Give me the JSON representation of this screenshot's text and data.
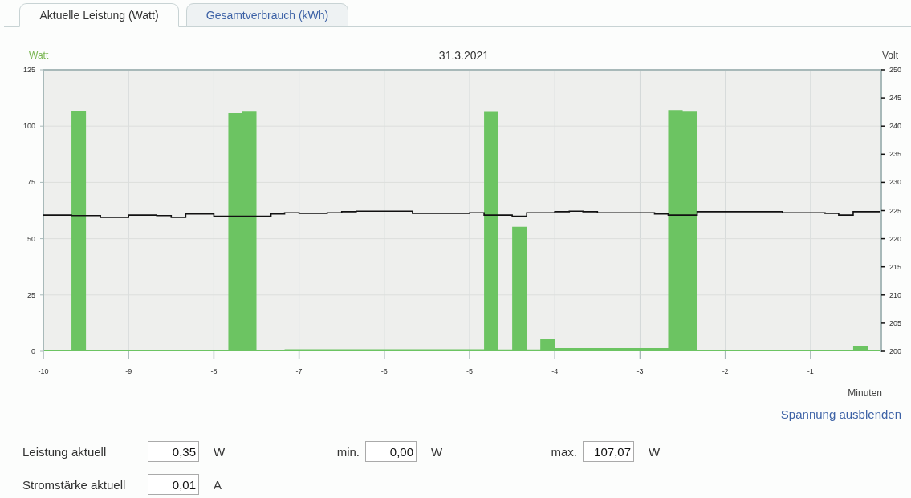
{
  "tabs": [
    {
      "label": "Aktuelle Leistung (Watt)",
      "selected": true
    },
    {
      "label": "Gesamtverbrauch (kWh)",
      "selected": false
    }
  ],
  "chart": {
    "chart_data": {
      "type": "area",
      "title": "31.3.2021",
      "xlabel": "Minuten",
      "ylabel": "Watt",
      "grid": true,
      "x": [
        -10,
        -9.83,
        -9.67,
        -9.5,
        -9.33,
        -9.17,
        -9,
        -8.83,
        -8.67,
        -8.5,
        -8.33,
        -8.17,
        -8,
        -7.83,
        -7.67,
        -7.5,
        -7.33,
        -7.17,
        -7,
        -6.83,
        -6.67,
        -6.5,
        -6.33,
        -6.17,
        -6,
        -5.83,
        -5.67,
        -5.5,
        -5.33,
        -5.17,
        -5,
        -4.83,
        -4.67,
        -4.5,
        -4.33,
        -4.17,
        -4,
        -3.83,
        -3.67,
        -3.5,
        -3.33,
        -3.17,
        -3,
        -2.83,
        -2.67,
        -2.5,
        -2.33,
        -2.17,
        -2,
        -1.83,
        -1.67,
        -1.5,
        -1.33,
        -1.17,
        -1,
        -0.83,
        -0.67,
        -0.5,
        -0.33,
        -0.17
      ],
      "series": [
        {
          "color": "#6cc462",
          "values": [
            0.3,
            0.3,
            106.5,
            0.3,
            0.3,
            0.3,
            0.3,
            0.3,
            0.3,
            0.3,
            0.3,
            0.3,
            0.3,
            105.8,
            106.4,
            0.3,
            0.2,
            0.9,
            0.9,
            0.9,
            0.9,
            0.9,
            0.9,
            0.9,
            0.9,
            0.9,
            0.9,
            0.9,
            0.9,
            0.9,
            0.9,
            106.3,
            0.8,
            55.3,
            0.8,
            5.3,
            1.4,
            1.4,
            1.4,
            1.4,
            1.4,
            1.4,
            1.4,
            1.4,
            107.1,
            106.4,
            0.3,
            0.3,
            0.3,
            0.3,
            0.3,
            0.3,
            0.3,
            0.6,
            0.6,
            0.6,
            0.6,
            2.5,
            0.4,
            0.4
          ]
        }
      ],
      "xlim": [
        -10,
        -0.17
      ],
      "ylim": [
        0,
        125
      ],
      "xticks": [
        -10,
        -9,
        -8,
        -7,
        -6,
        -5,
        -4,
        -3,
        -2,
        -1
      ],
      "yticks": [
        0,
        25,
        50,
        75,
        100,
        125
      ]
    }
  },
  "voltage_chart": {
    "chart_data": {
      "type": "line",
      "ylabel": "Volt",
      "x": [
        -10,
        -9.83,
        -9.67,
        -9.5,
        -9.33,
        -9.17,
        -9,
        -8.83,
        -8.67,
        -8.5,
        -8.33,
        -8.17,
        -8,
        -7.83,
        -7.67,
        -7.5,
        -7.33,
        -7.17,
        -7,
        -6.83,
        -6.67,
        -6.5,
        -6.33,
        -6.17,
        -6,
        -5.83,
        -5.67,
        -5.5,
        -5.33,
        -5.17,
        -5,
        -4.83,
        -4.67,
        -4.5,
        -4.33,
        -4.17,
        -4,
        -3.83,
        -3.67,
        -3.5,
        -3.33,
        -3.17,
        -3,
        -2.83,
        -2.67,
        -2.5,
        -2.33,
        -2.17,
        -2,
        -1.83,
        -1.67,
        -1.5,
        -1.33,
        -1.17,
        -1,
        -0.83,
        -0.67,
        -0.5,
        -0.33,
        -0.17
      ],
      "series": [
        {
          "color": "#111111",
          "values": [
            224.2,
            224.2,
            224.1,
            224.1,
            223.8,
            223.8,
            224.2,
            224.2,
            224.1,
            223.8,
            224.4,
            224.4,
            224.0,
            224.0,
            224.0,
            224.0,
            224.4,
            224.6,
            224.5,
            224.5,
            224.6,
            224.8,
            224.9,
            224.9,
            224.9,
            224.9,
            224.5,
            224.5,
            224.5,
            224.5,
            224.6,
            224.2,
            224.2,
            224.0,
            224.6,
            224.6,
            224.8,
            224.9,
            224.8,
            224.6,
            224.6,
            224.6,
            224.6,
            224.4,
            224.2,
            224.2,
            224.8,
            224.8,
            224.8,
            224.8,
            224.8,
            224.8,
            224.6,
            224.6,
            224.6,
            224.5,
            224.2,
            224.8,
            224.8,
            224.8
          ]
        }
      ],
      "xlim": [
        -10,
        -0.17
      ],
      "ylim": [
        200,
        250
      ],
      "yticks": [
        200,
        205,
        210,
        215,
        220,
        225,
        230,
        235,
        240,
        245,
        250
      ]
    }
  },
  "toggle_link": "Spannung ausblenden",
  "readings": [
    [
      {
        "label": "Leistung aktuell",
        "value": "0,35",
        "unit": "W"
      },
      {
        "label": "min.",
        "value": "0,00",
        "unit": "W"
      },
      {
        "label": "max.",
        "value": "107,07",
        "unit": "W"
      }
    ],
    [
      {
        "label": "Stromstärke aktuell",
        "value": "0,01",
        "unit": "A"
      }
    ]
  ]
}
